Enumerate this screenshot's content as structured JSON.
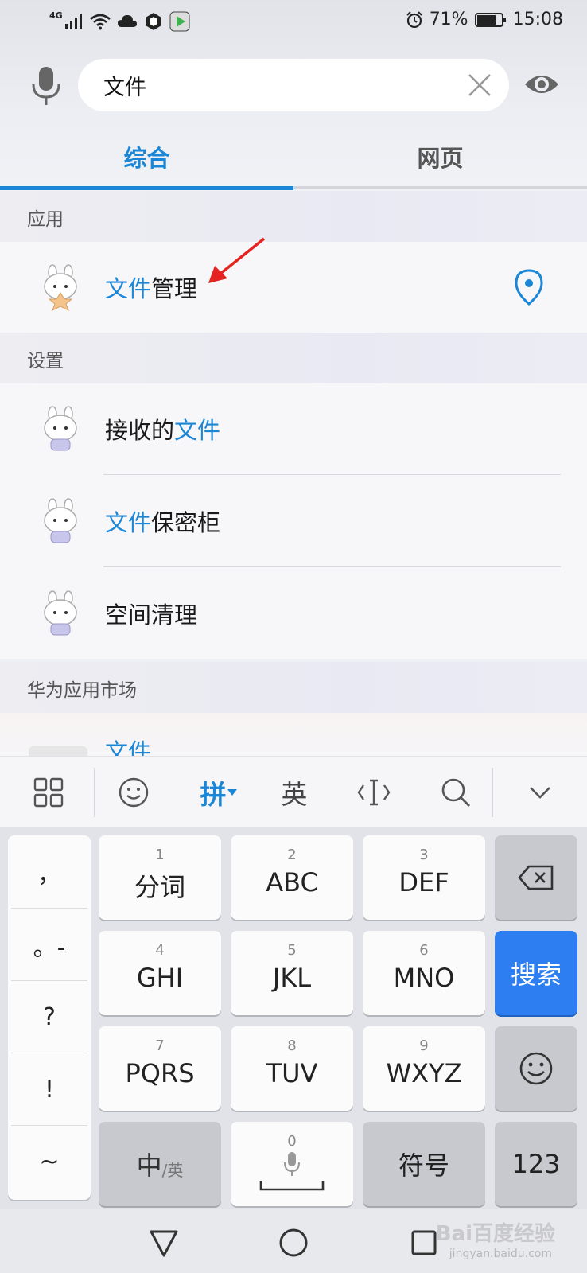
{
  "status_bar": {
    "network": "4G",
    "battery": "71%",
    "time": "15:08"
  },
  "search": {
    "query": "文件",
    "mic_icon": "microphone-icon",
    "clear_icon": "close-icon",
    "eye_icon": "eye-icon"
  },
  "tabs": [
    {
      "label": "综合",
      "active": true
    },
    {
      "label": "网页",
      "active": false
    }
  ],
  "sections": {
    "apps": {
      "header": "应用",
      "items": [
        {
          "highlight": "文件",
          "rest": "管理"
        }
      ]
    },
    "settings": {
      "header": "设置",
      "items": [
        {
          "prefix": "接收的",
          "highlight": "文件",
          "rest": ""
        },
        {
          "prefix": "",
          "highlight": "文件",
          "rest": "保密柜"
        },
        {
          "prefix": "空间清理",
          "highlight": "",
          "rest": ""
        }
      ]
    },
    "market": {
      "header": "华为应用市场",
      "peek_text": "文件"
    }
  },
  "ime_toolbar": {
    "pinyin": "拼",
    "english": "英"
  },
  "keyboard": {
    "punctuation": [
      "，",
      "。-",
      "?",
      "!",
      "~"
    ],
    "keys": [
      {
        "num": "1",
        "label": "分词"
      },
      {
        "num": "2",
        "label": "ABC"
      },
      {
        "num": "3",
        "label": "DEF"
      },
      {
        "num": "4",
        "label": "GHI"
      },
      {
        "num": "5",
        "label": "JKL"
      },
      {
        "num": "6",
        "label": "MNO"
      },
      {
        "num": "7",
        "label": "PQRS"
      },
      {
        "num": "8",
        "label": "TUV"
      },
      {
        "num": "9",
        "label": "WXYZ"
      }
    ],
    "search_key": "搜索",
    "lang_switch_main": "中",
    "lang_switch_sub": "/英",
    "space_num": "0",
    "symbols_key": "符号",
    "numbers_key": "123"
  },
  "watermark": {
    "brand": "Bai百度经验",
    "url": "jingyan.baidu.com"
  },
  "colors": {
    "accent": "#1b86d6",
    "search_key": "#2d7ef0",
    "arrow": "#e52421"
  }
}
